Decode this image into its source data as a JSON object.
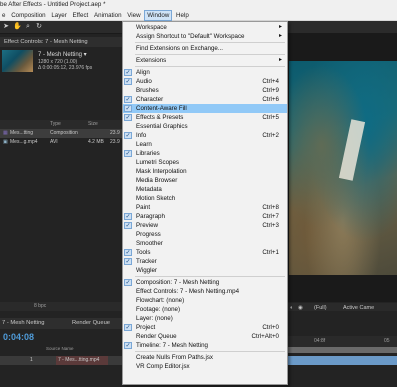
{
  "window": {
    "title": "be After Effects - Untitled Project.aep *"
  },
  "menubar": [
    "e",
    "Composition",
    "Layer",
    "Effect",
    "Animation",
    "View",
    "Window",
    "Help"
  ],
  "menubar_active": "Window",
  "project": {
    "tab": "Effect Controls: 7 - Mesh Netting",
    "item_name": "7 - Mesh Netting ▾",
    "item_dims": "1280 x 720 (1.00)",
    "item_dur": "Δ 0:00:05:12, 23.976 fps",
    "col_type": "Type",
    "col_size": "Size",
    "rows": [
      {
        "name": "Mes...tting",
        "type": "Composition",
        "size": "",
        "fps": "23.9"
      },
      {
        "name": "Mes...g.mp4",
        "type": "AVI",
        "size": "4.2 MB",
        "fps": "23.9"
      }
    ],
    "bpc": "8 bpc"
  },
  "timeline": {
    "tab1": "7 - Mesh Netting",
    "tab2": "Render Queue",
    "timecode": "0:04:08",
    "layer_num": "1",
    "layer_name": "7 - Mes...tting.mp4",
    "col_source": "Source Name",
    "ruler_mark": "04:8f",
    "ruler_end": "05"
  },
  "viewer": {
    "zoom": "(Full)",
    "camera": "Active Came"
  },
  "window_menu": [
    {
      "label": "Workspace",
      "arrow": true
    },
    {
      "label": "Assign Shortcut to \"Default\" Workspace",
      "arrow": true
    },
    {
      "sep": true
    },
    {
      "label": "Find Extensions on Exchange..."
    },
    {
      "sep": true
    },
    {
      "label": "Extensions",
      "arrow": true
    },
    {
      "sep": true
    },
    {
      "label": "Align",
      "checked": true
    },
    {
      "label": "Audio",
      "shortcut": "Ctrl+4",
      "checked": true
    },
    {
      "label": "Brushes",
      "shortcut": "Ctrl+9"
    },
    {
      "label": "Character",
      "shortcut": "Ctrl+6",
      "checked": true
    },
    {
      "label": "Content-Aware Fill",
      "checked": true,
      "highlighted": true
    },
    {
      "label": "Effects & Presets",
      "shortcut": "Ctrl+5",
      "checked": true
    },
    {
      "label": "Essential Graphics"
    },
    {
      "label": "Info",
      "shortcut": "Ctrl+2",
      "checked": true
    },
    {
      "label": "Learn"
    },
    {
      "label": "Libraries",
      "checked": true
    },
    {
      "label": "Lumetri Scopes"
    },
    {
      "label": "Mask Interpolation"
    },
    {
      "label": "Media Browser"
    },
    {
      "label": "Metadata"
    },
    {
      "label": "Motion Sketch"
    },
    {
      "label": "Paint",
      "shortcut": "Ctrl+8"
    },
    {
      "label": "Paragraph",
      "shortcut": "Ctrl+7",
      "checked": true
    },
    {
      "label": "Preview",
      "shortcut": "Ctrl+3",
      "checked": true
    },
    {
      "label": "Progress"
    },
    {
      "label": "Smoother"
    },
    {
      "label": "Tools",
      "shortcut": "Ctrl+1",
      "checked": true
    },
    {
      "label": "Tracker",
      "checked": true
    },
    {
      "label": "Wiggler"
    },
    {
      "sep": true
    },
    {
      "label": "Composition: 7 - Mesh Netting",
      "checked": true
    },
    {
      "label": "Effect Controls: 7 - Mesh Netting.mp4"
    },
    {
      "label": "Flowchart: (none)"
    },
    {
      "label": "Footage: (none)"
    },
    {
      "label": "Layer: (none)"
    },
    {
      "label": "Project",
      "shortcut": "Ctrl+0",
      "checked": true
    },
    {
      "label": "Render Queue",
      "shortcut": "Ctrl+Alt+0"
    },
    {
      "label": "Timeline: 7 - Mesh Netting",
      "checked": true
    },
    {
      "sep": true
    },
    {
      "label": "Create Nulls From Paths.jsx"
    },
    {
      "label": "VR Comp Editor.jsx"
    }
  ]
}
